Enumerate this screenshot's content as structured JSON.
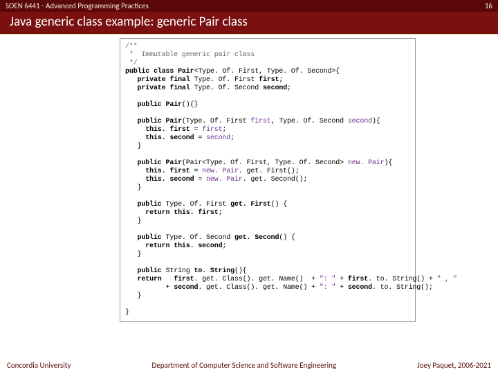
{
  "header": {
    "course": "SOEN 6441 - Advanced Programming Practices",
    "page_number": "16"
  },
  "title": "Java generic class example: generic Pair class",
  "code": {
    "c01": "/**",
    "c02": " *  Immutable generic pair class",
    "c03": " */",
    "c04a": "public class ",
    "c04b": "Pair",
    "c04c": "<Type. Of. First, Type. Of. Second>{",
    "c05a": "   private final ",
    "c05b": "Type. Of. First ",
    "c05c": "first",
    "c05d": ";",
    "c06a": "   private final ",
    "c06b": "Type. Of. Second ",
    "c06c": "second",
    "c06d": ";",
    "blank1": "",
    "c07a": "   public ",
    "c07b": "Pair",
    "c07c": "(){}",
    "blank2": "",
    "c08a": "   public ",
    "c08b": "Pair",
    "c08c": "(Type. Of. First ",
    "c08d": "first",
    "c08e": ", Type. Of. Second ",
    "c08f": "second",
    "c08g": "){",
    "c09a": "     this. ",
    "c09b": "first ",
    "c09c": "= ",
    "c09d": "first",
    "c09e": ";",
    "c10a": "     this. ",
    "c10b": "second ",
    "c10c": "= ",
    "c10d": "second",
    "c10e": ";",
    "c11": "   }",
    "blank3": "",
    "c12a": "   public ",
    "c12b": "Pair",
    "c12c": "(Pair<Type. Of. First, Type. Of. Second> ",
    "c12d": "new. Pair",
    "c12e": "){",
    "c13a": "     this. ",
    "c13b": "first ",
    "c13c": "= ",
    "c13d": "new. Pair",
    "c13e": ". get. First();",
    "c14a": "     this. ",
    "c14b": "second ",
    "c14c": "= ",
    "c14d": "new. Pair",
    "c14e": ". get. Second();",
    "c15": "   }",
    "blank4": "",
    "c16a": "   public ",
    "c16b": "Type. Of. First ",
    "c16c": "get. First",
    "c16d": "() {",
    "c17a": "     return this. ",
    "c17b": "first",
    "c17c": ";",
    "c18": "   }",
    "blank5": "",
    "c19a": "   public ",
    "c19b": "Type. Of. Second ",
    "c19c": "get. Second",
    "c19d": "() {",
    "c20a": "     return this. ",
    "c20b": "second",
    "c20c": ";",
    "c21": "   }",
    "blank6": "",
    "c22a": "   public ",
    "c22b": "String ",
    "c22c": "to. String",
    "c22d": "(){",
    "c23a": "   return   ",
    "c23b": "first",
    "c23c": ". get. Class(). get. Name()  + ",
    "c23d": "\": \"",
    "c23e": " + ",
    "c23f": "first",
    "c23g": ". to. String() + ",
    "c23h": "\" , \"",
    "c24a": "          + ",
    "c24b": "second",
    "c24c": ". get. Class(). get. Name() + ",
    "c24d": "\": \"",
    "c24e": " + ",
    "c24f": "second",
    "c24g": ". to. String();",
    "c25": "   }",
    "blank7": "",
    "c26": "}"
  },
  "footer": {
    "left": "Concordia University",
    "center": "Department of Computer Science and Software Engineering",
    "right": "Joey Paquet, 2006-2021"
  }
}
